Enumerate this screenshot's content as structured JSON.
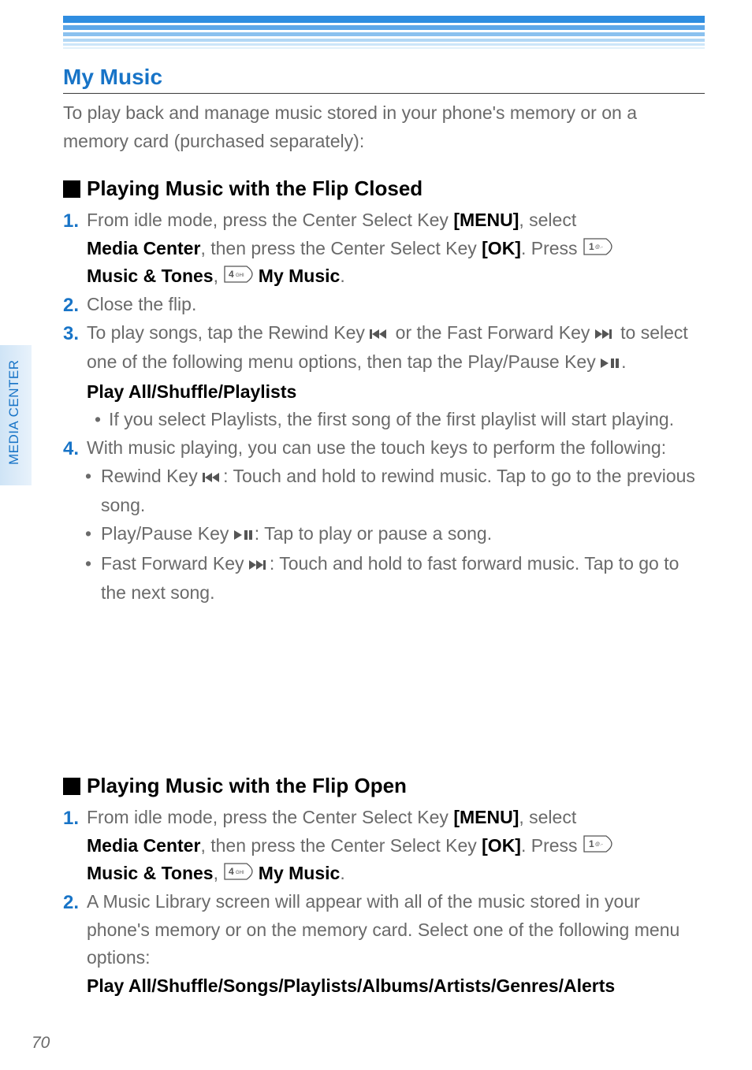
{
  "sidebar": {
    "label": "MEDIA CENTER"
  },
  "page_number": "70",
  "section_title": "My Music",
  "intro": "To play back and manage music stored in your phone's memory or on a memory card (purchased separately):",
  "sections": {
    "closed": {
      "heading": "Playing Music with the Flip Closed",
      "s1": {
        "num": "1.",
        "t1": "From idle mode, press the Center Select Key ",
        "menu": "[MENU]",
        "t2": ", select ",
        "mc": "Media Center",
        "t3": ", then press the Center Select Key ",
        "ok": "[OK]",
        "t4": ". Press ",
        "mt": "Music & Tones",
        "t5": ", ",
        "mm": "My Music",
        "t6": "."
      },
      "s2": {
        "num": "2.",
        "text": "Close the flip."
      },
      "s3": {
        "num": "3.",
        "t1": "To play songs, tap the Rewind Key ",
        "t2": " or the Fast Forward Key ",
        "t3": " to select one of the following menu options, then tap the Play/Pause Key ",
        "t4": "."
      },
      "playall": "Play All/Shuffle/Playlists",
      "bullet_playlists": "If you select Playlists, the first song of the first playlist will start playing.",
      "s4": {
        "num": "4.",
        "text": "With music playing, you can use the touch keys to perform the following:"
      },
      "b_rewind": {
        "t1": "Rewind Key ",
        "t2": ": Touch and hold to rewind music. Tap to go to the previous song."
      },
      "b_playpause": {
        "t1": "Play/Pause Key ",
        "t2": ": Tap to play or pause a song."
      },
      "b_ff": {
        "t1": "Fast Forward Key ",
        "t2": ": Touch and hold to fast forward music. Tap to go to the next song."
      }
    },
    "open": {
      "heading": "Playing Music with the Flip Open",
      "s1": {
        "num": "1.",
        "t1": "From idle mode, press the Center Select Key ",
        "menu": "[MENU]",
        "t2": ", select ",
        "mc": "Media Center",
        "t3": ", then press the Center Select Key ",
        "ok": "[OK]",
        "t4": ". Press ",
        "mt": "Music & Tones",
        "t5": ", ",
        "mm": "My Music",
        "t6": "."
      },
      "s2": {
        "num": "2.",
        "text": "A Music Library screen will appear with all of the music stored in your phone's memory or on the memory card. Select one of the following menu options:"
      },
      "playall": "Play All/Shuffle/Songs/Playlists/Albums/Artists/Genres/Alerts"
    }
  },
  "keycaps": {
    "key1": "1",
    "key1_sub": "@.-",
    "key4": "4",
    "key4_sub": "GHI"
  }
}
